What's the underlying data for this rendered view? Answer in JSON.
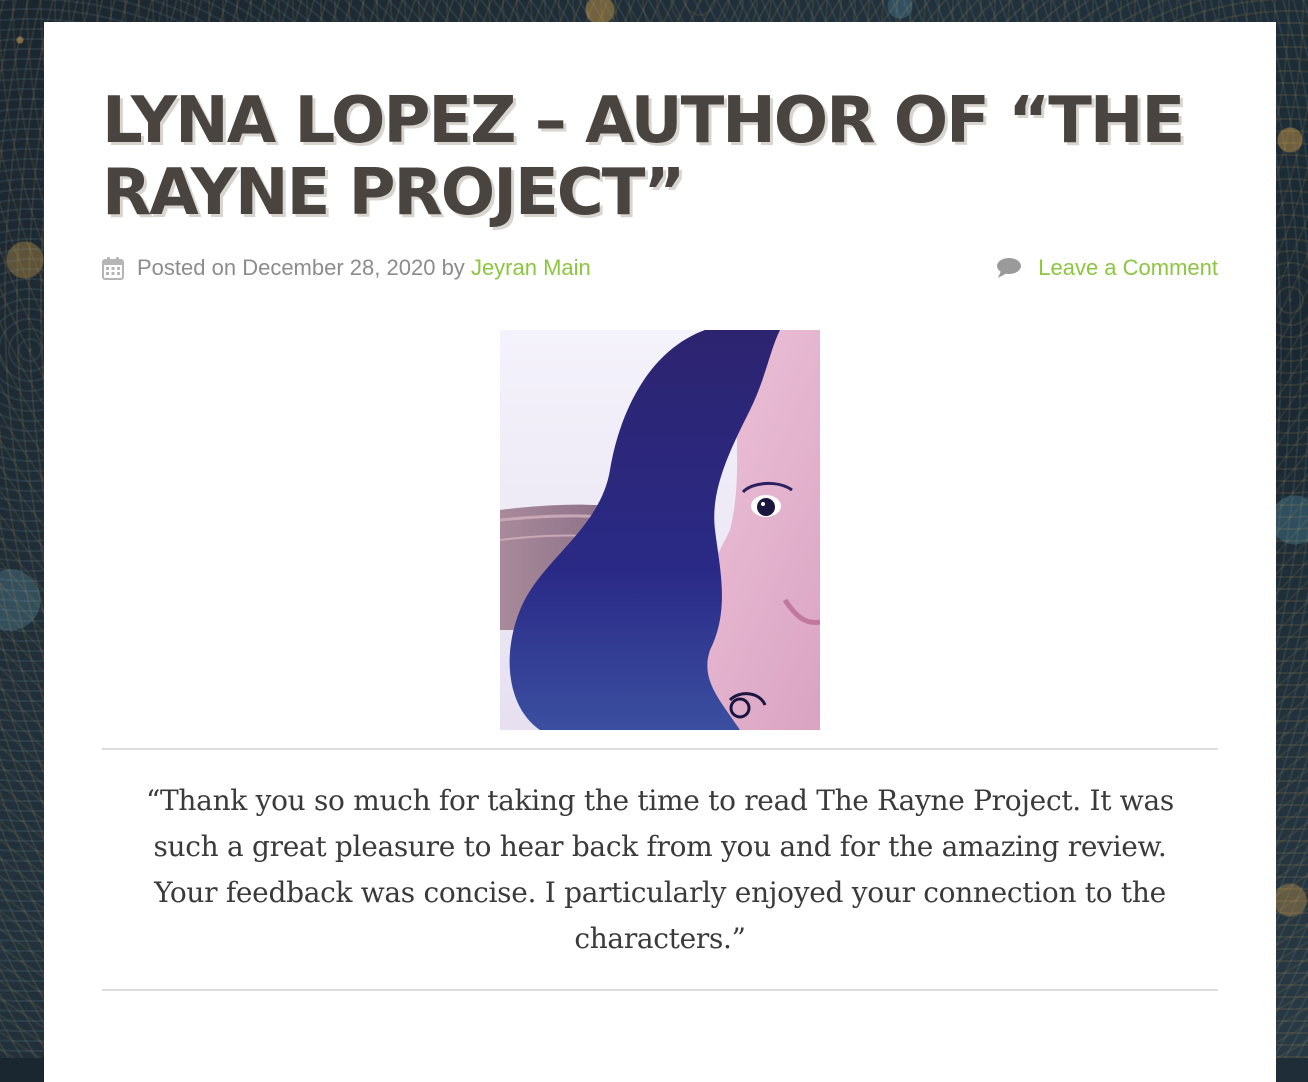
{
  "post": {
    "title": "LYNA LOPEZ – AUTHOR OF “THE RAYNE PROJECT”",
    "meta": {
      "posted_on_label": "Posted on",
      "date": "December 28, 2020",
      "by_label": "by",
      "author": "Jeyran Main",
      "comment_link": "Leave a Comment"
    },
    "quote": "“Thank you so much for taking the time to read The Rayne Project. It was such a great pleasure to hear back from you and for the amazing review. Your feedback was concise. I particularly enjoyed your connection to the characters.”"
  },
  "icons": {
    "date": "calendar-icon",
    "comments": "comment-icon"
  },
  "colors": {
    "title": "#4a4440",
    "link": "#8cc63f",
    "meta_text": "#8c8c8c",
    "divider": "#dcdcdc"
  }
}
